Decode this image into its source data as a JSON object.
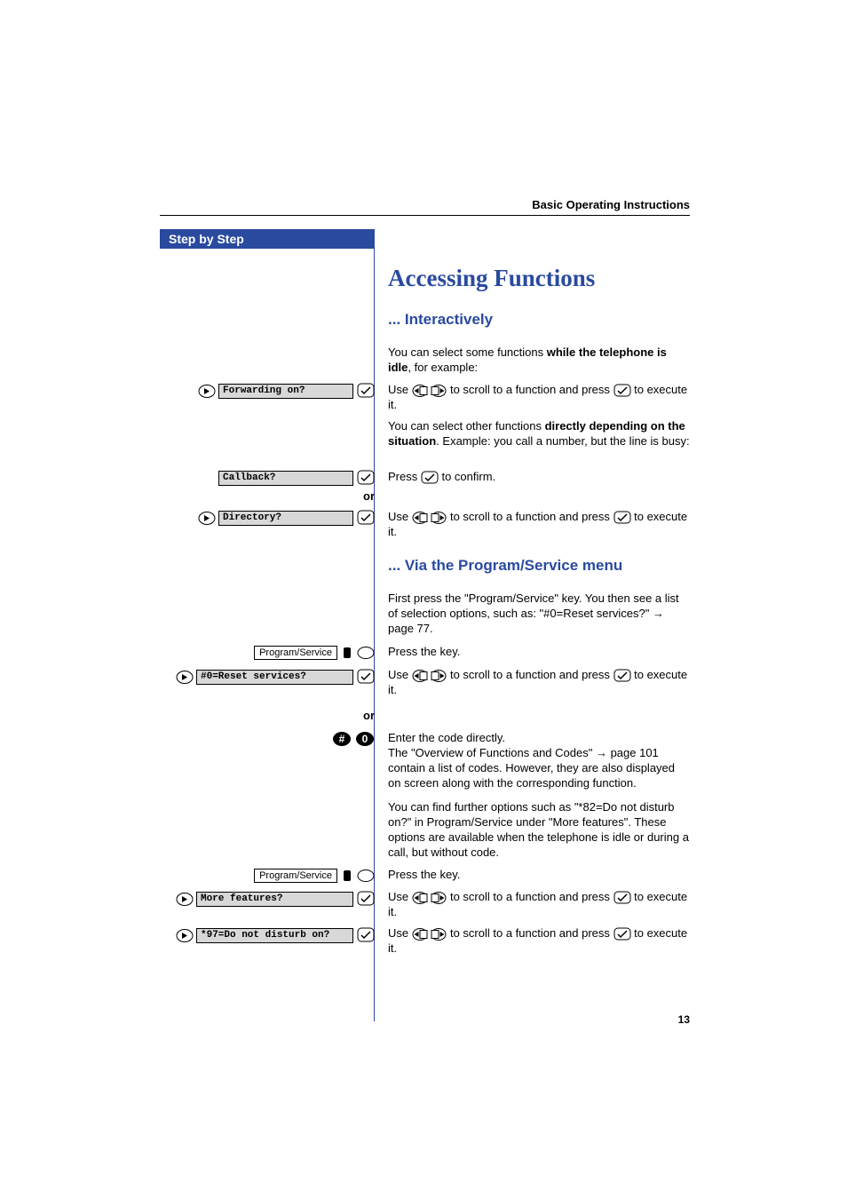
{
  "header": "Basic Operating Instructions",
  "step_banner": "Step by Step",
  "title": "Accessing Functions",
  "sub1": "... Interactively",
  "sub2": "... Via the Program/Service menu",
  "page_number": "13",
  "or": "or",
  "left": {
    "forwarding": "Forwarding on?",
    "callback": "Callback?",
    "directory": "Directory?",
    "program_service": "Program/Service",
    "reset": "#0=Reset services?",
    "more_features": "More features?",
    "dnd": "*97=Do not disturb on?"
  },
  "body": {
    "p1a": "You can select some functions ",
    "p1b": "while the telephone is idle",
    "p1c": ", for example:",
    "use": "Use ",
    "scroll_mid": " to scroll to a function and press ",
    "scroll_end": " to execute it.",
    "p2a": "You can select other functions ",
    "p2b": "directly depending on the situation",
    "p2c": ". Example:  you call a number, but the line is busy:",
    "press": "Press ",
    "confirm": " to confirm.",
    "svc1": "First press the \"Program/Service\" key. You then see a list of selection options, such as: \"#0=Reset services?\" ",
    "svc1_page": " page 77.",
    "press_key": "Press the key.",
    "code1": "Enter the code directly.",
    "code2a": "The \"Overview of Functions and Codes\" ",
    "code2b": " page 101 contain a list of codes. However, they are also displayed on screen along with the corresponding function.",
    "more_opts": "You can find further options such as \"*82=Do not disturb on?\" in Program/Service under \"More features\". These options are available when the telephone is idle or during a call, but without code."
  }
}
